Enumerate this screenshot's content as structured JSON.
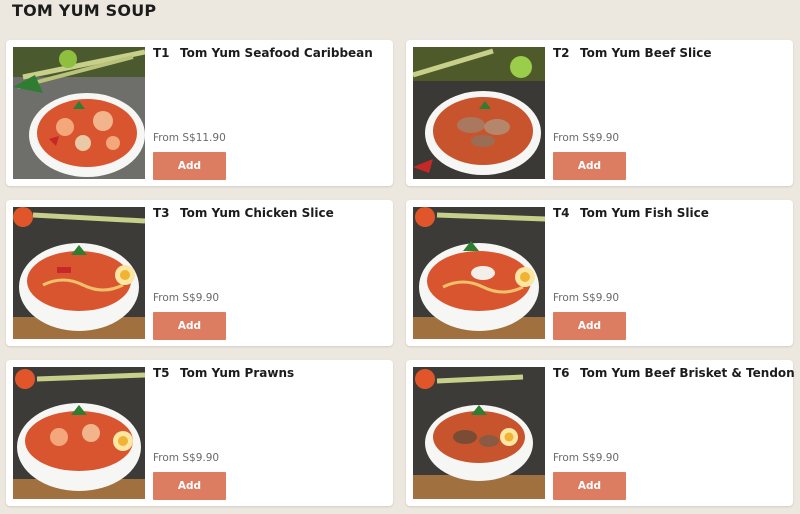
{
  "section": {
    "title": "TOM YUM SOUP"
  },
  "items": [
    {
      "code": "T1",
      "name": "Tom Yum Seafood Caribbean",
      "price": "From S$11.90",
      "add_label": "Add",
      "photo": "tom-yum-seafood-bowl-image"
    },
    {
      "code": "T2",
      "name": "Tom Yum Beef Slice",
      "price": "From S$9.90",
      "add_label": "Add",
      "photo": "tom-yum-beef-bowl-image"
    },
    {
      "code": "T3",
      "name": "Tom Yum Chicken Slice",
      "price": "From S$9.90",
      "add_label": "Add",
      "photo": "tom-yum-chicken-bowl-image"
    },
    {
      "code": "T4",
      "name": "Tom Yum Fish Slice",
      "price": "From S$9.90",
      "add_label": "Add",
      "photo": "tom-yum-fish-bowl-image"
    },
    {
      "code": "T5",
      "name": "Tom Yum Prawns",
      "price": "From S$9.90",
      "add_label": "Add",
      "photo": "tom-yum-prawns-bowl-image"
    },
    {
      "code": "T6",
      "name": "Tom Yum Beef Brisket & Tendon",
      "price": "From S$9.90",
      "add_label": "Add",
      "photo": "tom-yum-brisket-bowl-image"
    }
  ],
  "colors": {
    "page_background": "#ede8df",
    "card_background": "#ffffff",
    "add_button": "#dc7d61",
    "soup": "#d9552f"
  }
}
